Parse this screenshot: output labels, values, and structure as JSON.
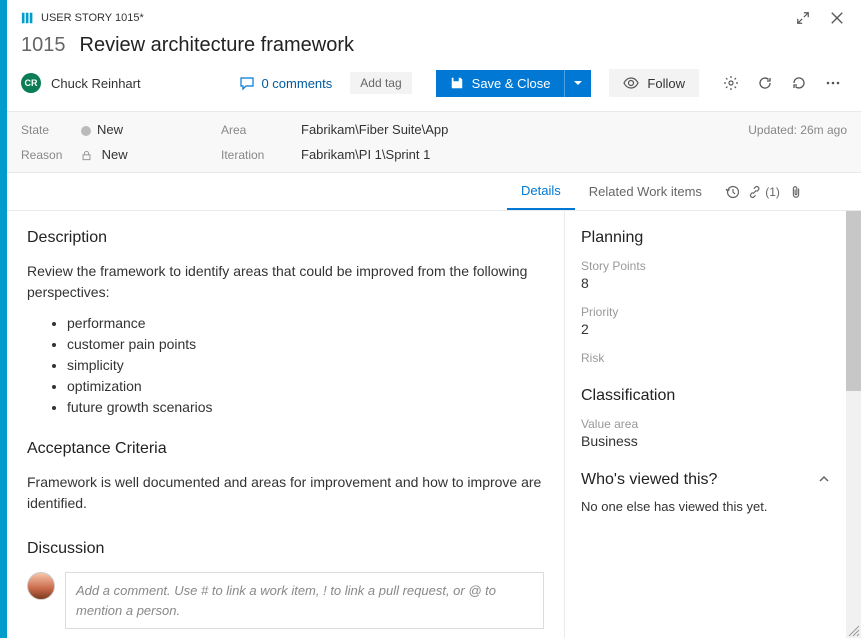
{
  "header": {
    "type_label": "USER STORY 1015*",
    "id": "1015",
    "title": "Review architecture framework",
    "assignee": "Chuck Reinhart",
    "assignee_initials": "CR",
    "comments_label": "0 comments",
    "add_tag_label": "Add tag",
    "save_close_label": "Save & Close",
    "follow_label": "Follow"
  },
  "info": {
    "state_label": "State",
    "state_value": "New",
    "reason_label": "Reason",
    "reason_value": "New",
    "area_label": "Area",
    "area_value": "Fabrikam\\Fiber Suite\\App",
    "iteration_label": "Iteration",
    "iteration_value": "Fabrikam\\PI 1\\Sprint 1",
    "updated_label": "Updated: 26m ago"
  },
  "tabs": {
    "details": "Details",
    "related": "Related Work items",
    "links_count": "(1)"
  },
  "left": {
    "description_title": "Description",
    "description_intro": "Review the framework to identify areas that could be improved from the following perspectives:",
    "bullets": [
      "performance",
      "customer pain points",
      "simplicity",
      "optimization",
      "future growth scenarios"
    ],
    "acceptance_title": "Acceptance Criteria",
    "acceptance_text": "Framework is well documented and areas for improvement and how to improve are identified.",
    "discussion_title": "Discussion",
    "discussion_placeholder": "Add a comment. Use # to link a work item, ! to link a pull request, or @ to mention a person."
  },
  "right": {
    "planning_title": "Planning",
    "story_points_label": "Story Points",
    "story_points_value": "8",
    "priority_label": "Priority",
    "priority_value": "2",
    "risk_label": "Risk",
    "classification_title": "Classification",
    "value_area_label": "Value area",
    "value_area_value": "Business",
    "viewed_title": "Who's viewed this?",
    "viewed_text": "No one else has viewed this yet."
  }
}
